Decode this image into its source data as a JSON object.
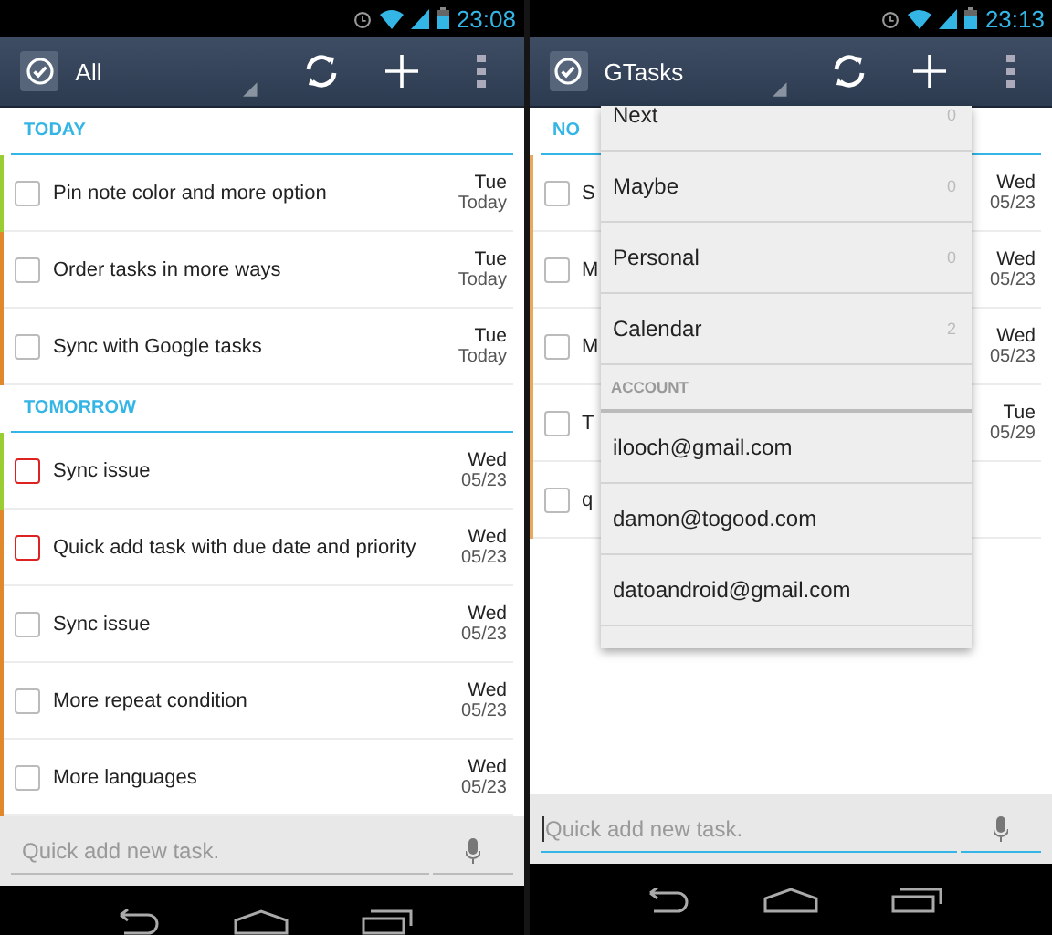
{
  "screens": [
    {
      "status_bar": {
        "time": "23:08"
      },
      "action_bar": {
        "title": "All"
      },
      "sections": [
        {
          "header": "TODAY",
          "tasks": [
            {
              "title": "Pin note color and more option",
              "day": "Tue",
              "date": "Today",
              "color": "#9acd32",
              "kind": "normal"
            },
            {
              "title": "Order tasks in more ways",
              "day": "Tue",
              "date": "Today",
              "color": "#e0892c",
              "kind": "normal"
            },
            {
              "title": "Sync with Google tasks",
              "day": "Tue",
              "date": "Today",
              "color": "#e0892c",
              "kind": "normal"
            }
          ]
        },
        {
          "header": "TOMORROW",
          "tasks": [
            {
              "title": "Sync issue",
              "day": "Wed",
              "date": "05/23",
              "color": "#9acd32",
              "kind": "urgent"
            },
            {
              "title": "Quick add task with due date and priority",
              "day": "Wed",
              "date": "05/23",
              "color": "#e0892c",
              "kind": "urgent"
            },
            {
              "title": "Sync issue",
              "day": "Wed",
              "date": "05/23",
              "color": "#e0892c",
              "kind": "normal"
            },
            {
              "title": "More repeat condition",
              "day": "Wed",
              "date": "05/23",
              "color": "#e0892c",
              "kind": "normal"
            },
            {
              "title": "More languages",
              "day": "Wed",
              "date": "05/23",
              "color": "#e0892c",
              "kind": "normal"
            }
          ]
        }
      ],
      "quick_add": {
        "placeholder": "Quick add new task.",
        "focused": false
      }
    },
    {
      "status_bar": {
        "time": "23:13"
      },
      "action_bar": {
        "title": "GTasks"
      },
      "sections": [
        {
          "header": "NO",
          "tasks": [
            {
              "title": "S",
              "day": "Wed",
              "date": "05/23",
              "color": "#e8a860",
              "kind": "normal"
            },
            {
              "title": "M",
              "day": "Wed",
              "date": "05/23",
              "color": "#e8a860",
              "kind": "normal"
            },
            {
              "title": "M",
              "day": "Wed",
              "date": "05/23",
              "color": "#e8a860",
              "kind": "normal"
            },
            {
              "title": "T",
              "day": "Tue",
              "date": "05/29",
              "color": "#e8a860",
              "kind": "normal"
            },
            {
              "title": "q",
              "color": "#e8a860",
              "kind": "normal"
            }
          ]
        }
      ],
      "dropdown": {
        "items": [
          {
            "kind": "list",
            "label": "Next",
            "count": "0"
          },
          {
            "kind": "list",
            "label": "Maybe",
            "count": "0"
          },
          {
            "kind": "list",
            "label": "Personal",
            "count": "0"
          },
          {
            "kind": "list",
            "label": "Calendar",
            "count": "2"
          },
          {
            "kind": "header",
            "label": "ACCOUNT"
          },
          {
            "kind": "account",
            "label": "ilooch@gmail.com"
          },
          {
            "kind": "account",
            "label": "damon@togood.com"
          },
          {
            "kind": "account",
            "label": "datoandroid@gmail.com"
          }
        ]
      },
      "quick_add": {
        "placeholder": "Quick add new task.",
        "focused": true
      }
    }
  ]
}
